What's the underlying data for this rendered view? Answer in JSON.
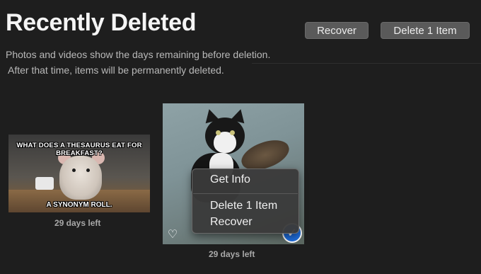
{
  "page": {
    "title": "Recently Deleted",
    "subtitle_line1": "Photos and videos show the days remaining before deletion.",
    "subtitle_line2": "After that time, items will be permanently deleted."
  },
  "toolbar": {
    "recover_label": "Recover",
    "delete_label": "Delete 1 Item"
  },
  "items": [
    {
      "meme_top": "WHAT DOES A THESAURUS EAT FOR BREAKFAST?",
      "meme_bottom": "A SYNONYM ROLL.",
      "days_left": "29 days left"
    },
    {
      "days_left": "29 days left",
      "favorite_icon": "heart-outline-icon",
      "selected": true
    }
  ],
  "context_menu": {
    "items": [
      "Get Info",
      "Delete 1 Item",
      "Recover"
    ]
  },
  "colors": {
    "background": "#1e1e1e",
    "button": "#5a5a5a",
    "accent": "#1f6fe0"
  }
}
